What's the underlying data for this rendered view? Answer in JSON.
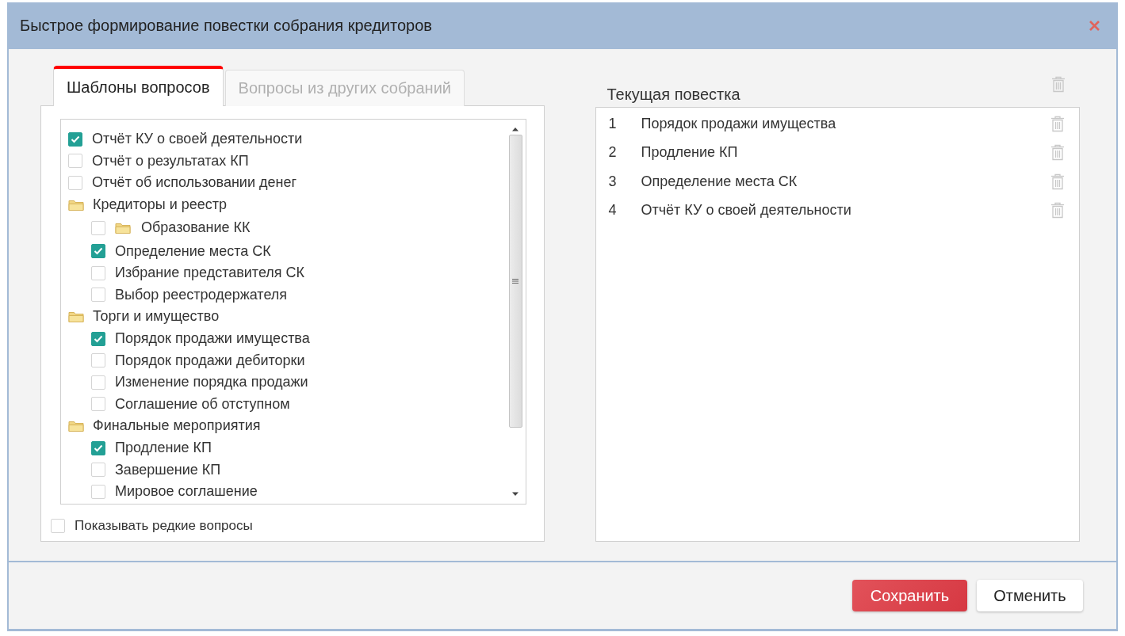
{
  "window": {
    "title": "Быстрое формирование повестки собрания кредиторов"
  },
  "tabs": [
    {
      "label": "Шаблоны вопросов",
      "selected": true
    },
    {
      "label": "Вопросы из других собраний",
      "selected": false
    }
  ],
  "tree": {
    "items": [
      {
        "kind": "item",
        "label": "Отчёт КУ о своей деятельности",
        "checked": true
      },
      {
        "kind": "item",
        "label": "Отчёт о результатах КП",
        "checked": false
      },
      {
        "kind": "item",
        "label": "Отчёт об использовании денег",
        "checked": false
      },
      {
        "kind": "folder",
        "label": "Кредиторы и реестр",
        "children": [
          {
            "kind": "checkfolder",
            "label": "Образование КК",
            "checked": false
          },
          {
            "kind": "item",
            "label": "Определение места СК",
            "checked": true
          },
          {
            "kind": "item",
            "label": "Избрание представителя СК",
            "checked": false
          },
          {
            "kind": "item",
            "label": "Выбор реестродержателя",
            "checked": false
          }
        ]
      },
      {
        "kind": "folder",
        "label": "Торги и имущество",
        "children": [
          {
            "kind": "item",
            "label": "Порядок продажи имущества",
            "checked": true
          },
          {
            "kind": "item",
            "label": "Порядок продажи дебиторки",
            "checked": false
          },
          {
            "kind": "item",
            "label": "Изменение порядка продажи",
            "checked": false
          },
          {
            "kind": "item",
            "label": "Соглашение об отступном",
            "checked": false
          }
        ]
      },
      {
        "kind": "folder",
        "label": "Финальные мероприятия",
        "children": [
          {
            "kind": "item",
            "label": "Продление КП",
            "checked": true
          },
          {
            "kind": "item",
            "label": "Завершение КП",
            "checked": false
          },
          {
            "kind": "item",
            "label": "Мировое соглашение",
            "checked": false
          }
        ]
      }
    ]
  },
  "show_rare": {
    "label": "Показывать редкие вопросы",
    "checked": false
  },
  "agenda": {
    "title": "Текущая повестка",
    "items": [
      {
        "number": "1",
        "text": "Порядок продажи имущества"
      },
      {
        "number": "2",
        "text": "Продление КП"
      },
      {
        "number": "3",
        "text": "Определение места СК"
      },
      {
        "number": "4",
        "text": "Отчёт КУ о своей деятельности"
      }
    ]
  },
  "buttons": [
    {
      "label": "Сохранить",
      "kind": "primary"
    },
    {
      "label": "Отменить",
      "kind": "secondary"
    }
  ]
}
